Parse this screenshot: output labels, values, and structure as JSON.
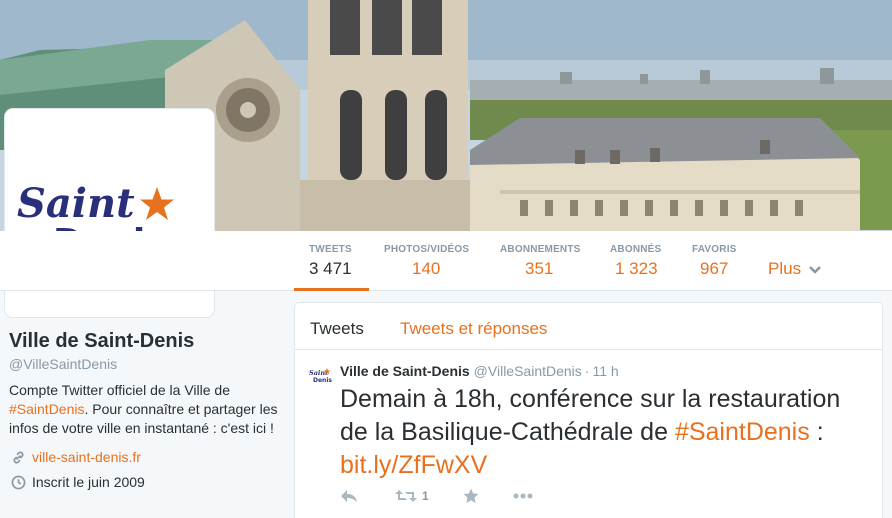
{
  "profile": {
    "name": "Ville de Saint-Denis",
    "handle": "@VilleSaintDenis",
    "bio_before": "Compte Twitter officiel de la Ville de ",
    "bio_hashtag": "#SaintDenis",
    "bio_after": ". Pour connaître et partager les infos de votre ville en instantané : c'est ici !",
    "website": "ville-saint-denis.fr",
    "joined": "Inscrit le juin 2009"
  },
  "avatar": {
    "logo_line1": "Saint",
    "logo_line2": "Denis"
  },
  "stats": [
    {
      "label": "TWEETS",
      "value": "3 471"
    },
    {
      "label": "PHOTOS/VIDÉOS",
      "value": "140"
    },
    {
      "label": "ABONNEMENTS",
      "value": "351"
    },
    {
      "label": "ABONNÉS",
      "value": "1 323"
    },
    {
      "label": "FAVORIS",
      "value": "967"
    }
  ],
  "more_label": "Plus",
  "tabs": [
    "Tweets",
    "Tweets et réponses"
  ],
  "tweet": {
    "author": "Ville de Saint-Denis",
    "handle": "@VilleSaintDenis",
    "separator": "·",
    "time": "11 h",
    "text_before": "Demain à 18h, conférence sur la restauration de la Basilique-Cathédrale de ",
    "hashtag": "#SaintDenis",
    "text_middle": " : ",
    "link": "bit.ly/ZfFwXV",
    "retweet_count": "1"
  },
  "colors": {
    "accent": "#e8711e",
    "logo_blue": "#2a2f7a",
    "text": "#292f33",
    "muted": "#8899a6"
  },
  "icons": [
    "link-icon",
    "calendar-icon",
    "reply-icon",
    "retweet-icon",
    "star-icon",
    "more-dots-icon",
    "chevron-down-icon"
  ]
}
